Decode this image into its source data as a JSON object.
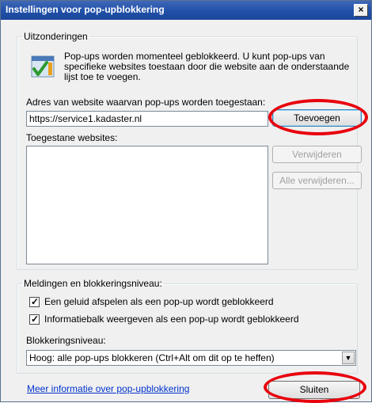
{
  "window": {
    "title": "Instellingen voor pop-upblokkering",
    "close_label": "×"
  },
  "exceptions": {
    "legend": "Uitzonderingen",
    "info_text": "Pop-ups worden momenteel geblokkeerd. U kunt pop-ups van specifieke websites toestaan door die website aan de onderstaande lijst toe te voegen.",
    "address_label": "Adres van website waarvan pop-ups worden toegestaan:",
    "address_value": "https://service1.kadaster.nl",
    "add_button": "Toevoegen",
    "allowed_label": "Toegestane websites:",
    "allowed_sites": [],
    "remove_button": "Verwijderen",
    "remove_all_button": "Alle verwijderen..."
  },
  "notifications": {
    "legend": "Meldingen en blokkeringsniveau:",
    "sound_label": "Een geluid afspelen als een pop-up wordt geblokkeerd",
    "sound_checked": true,
    "infobar_label": "Informatiebalk weergeven als een pop-up wordt geblokkeerd",
    "infobar_checked": true,
    "level_label": "Blokkeringsniveau:",
    "level_value": "Hoog: alle pop-ups blokkeren (Ctrl+Alt om dit op te heffen)"
  },
  "footer": {
    "more_info_link": "Meer informatie over pop-upblokkering",
    "close_button": "Sluiten"
  },
  "colors": {
    "annotation": "#e8000d",
    "titlebar": "#2050a8",
    "link": "#0033cc"
  },
  "icons": {
    "info": "checkmark-window-icon",
    "close": "close-icon",
    "dropdown": "chevron-down-icon"
  }
}
